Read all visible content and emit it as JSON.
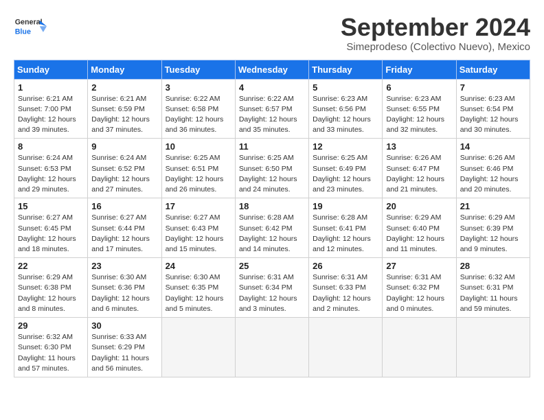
{
  "logo": {
    "line1": "General",
    "line2": "Blue"
  },
  "title": "September 2024",
  "subtitle": "Simeprodeso (Colectivo Nuevo), Mexico",
  "days_header": [
    "Sunday",
    "Monday",
    "Tuesday",
    "Wednesday",
    "Thursday",
    "Friday",
    "Saturday"
  ],
  "weeks": [
    [
      {
        "num": "1",
        "sunrise": "6:21 AM",
        "sunset": "7:00 PM",
        "daylight": "12 hours and 39 minutes."
      },
      {
        "num": "2",
        "sunrise": "6:21 AM",
        "sunset": "6:59 PM",
        "daylight": "12 hours and 37 minutes."
      },
      {
        "num": "3",
        "sunrise": "6:22 AM",
        "sunset": "6:58 PM",
        "daylight": "12 hours and 36 minutes."
      },
      {
        "num": "4",
        "sunrise": "6:22 AM",
        "sunset": "6:57 PM",
        "daylight": "12 hours and 35 minutes."
      },
      {
        "num": "5",
        "sunrise": "6:23 AM",
        "sunset": "6:56 PM",
        "daylight": "12 hours and 33 minutes."
      },
      {
        "num": "6",
        "sunrise": "6:23 AM",
        "sunset": "6:55 PM",
        "daylight": "12 hours and 32 minutes."
      },
      {
        "num": "7",
        "sunrise": "6:23 AM",
        "sunset": "6:54 PM",
        "daylight": "12 hours and 30 minutes."
      }
    ],
    [
      {
        "num": "8",
        "sunrise": "6:24 AM",
        "sunset": "6:53 PM",
        "daylight": "12 hours and 29 minutes."
      },
      {
        "num": "9",
        "sunrise": "6:24 AM",
        "sunset": "6:52 PM",
        "daylight": "12 hours and 27 minutes."
      },
      {
        "num": "10",
        "sunrise": "6:25 AM",
        "sunset": "6:51 PM",
        "daylight": "12 hours and 26 minutes."
      },
      {
        "num": "11",
        "sunrise": "6:25 AM",
        "sunset": "6:50 PM",
        "daylight": "12 hours and 24 minutes."
      },
      {
        "num": "12",
        "sunrise": "6:25 AM",
        "sunset": "6:49 PM",
        "daylight": "12 hours and 23 minutes."
      },
      {
        "num": "13",
        "sunrise": "6:26 AM",
        "sunset": "6:47 PM",
        "daylight": "12 hours and 21 minutes."
      },
      {
        "num": "14",
        "sunrise": "6:26 AM",
        "sunset": "6:46 PM",
        "daylight": "12 hours and 20 minutes."
      }
    ],
    [
      {
        "num": "15",
        "sunrise": "6:27 AM",
        "sunset": "6:45 PM",
        "daylight": "12 hours and 18 minutes."
      },
      {
        "num": "16",
        "sunrise": "6:27 AM",
        "sunset": "6:44 PM",
        "daylight": "12 hours and 17 minutes."
      },
      {
        "num": "17",
        "sunrise": "6:27 AM",
        "sunset": "6:43 PM",
        "daylight": "12 hours and 15 minutes."
      },
      {
        "num": "18",
        "sunrise": "6:28 AM",
        "sunset": "6:42 PM",
        "daylight": "12 hours and 14 minutes."
      },
      {
        "num": "19",
        "sunrise": "6:28 AM",
        "sunset": "6:41 PM",
        "daylight": "12 hours and 12 minutes."
      },
      {
        "num": "20",
        "sunrise": "6:29 AM",
        "sunset": "6:40 PM",
        "daylight": "12 hours and 11 minutes."
      },
      {
        "num": "21",
        "sunrise": "6:29 AM",
        "sunset": "6:39 PM",
        "daylight": "12 hours and 9 minutes."
      }
    ],
    [
      {
        "num": "22",
        "sunrise": "6:29 AM",
        "sunset": "6:38 PM",
        "daylight": "12 hours and 8 minutes."
      },
      {
        "num": "23",
        "sunrise": "6:30 AM",
        "sunset": "6:36 PM",
        "daylight": "12 hours and 6 minutes."
      },
      {
        "num": "24",
        "sunrise": "6:30 AM",
        "sunset": "6:35 PM",
        "daylight": "12 hours and 5 minutes."
      },
      {
        "num": "25",
        "sunrise": "6:31 AM",
        "sunset": "6:34 PM",
        "daylight": "12 hours and 3 minutes."
      },
      {
        "num": "26",
        "sunrise": "6:31 AM",
        "sunset": "6:33 PM",
        "daylight": "12 hours and 2 minutes."
      },
      {
        "num": "27",
        "sunrise": "6:31 AM",
        "sunset": "6:32 PM",
        "daylight": "12 hours and 0 minutes."
      },
      {
        "num": "28",
        "sunrise": "6:32 AM",
        "sunset": "6:31 PM",
        "daylight": "11 hours and 59 minutes."
      }
    ],
    [
      {
        "num": "29",
        "sunrise": "6:32 AM",
        "sunset": "6:30 PM",
        "daylight": "11 hours and 57 minutes."
      },
      {
        "num": "30",
        "sunrise": "6:33 AM",
        "sunset": "6:29 PM",
        "daylight": "11 hours and 56 minutes."
      },
      null,
      null,
      null,
      null,
      null
    ]
  ]
}
